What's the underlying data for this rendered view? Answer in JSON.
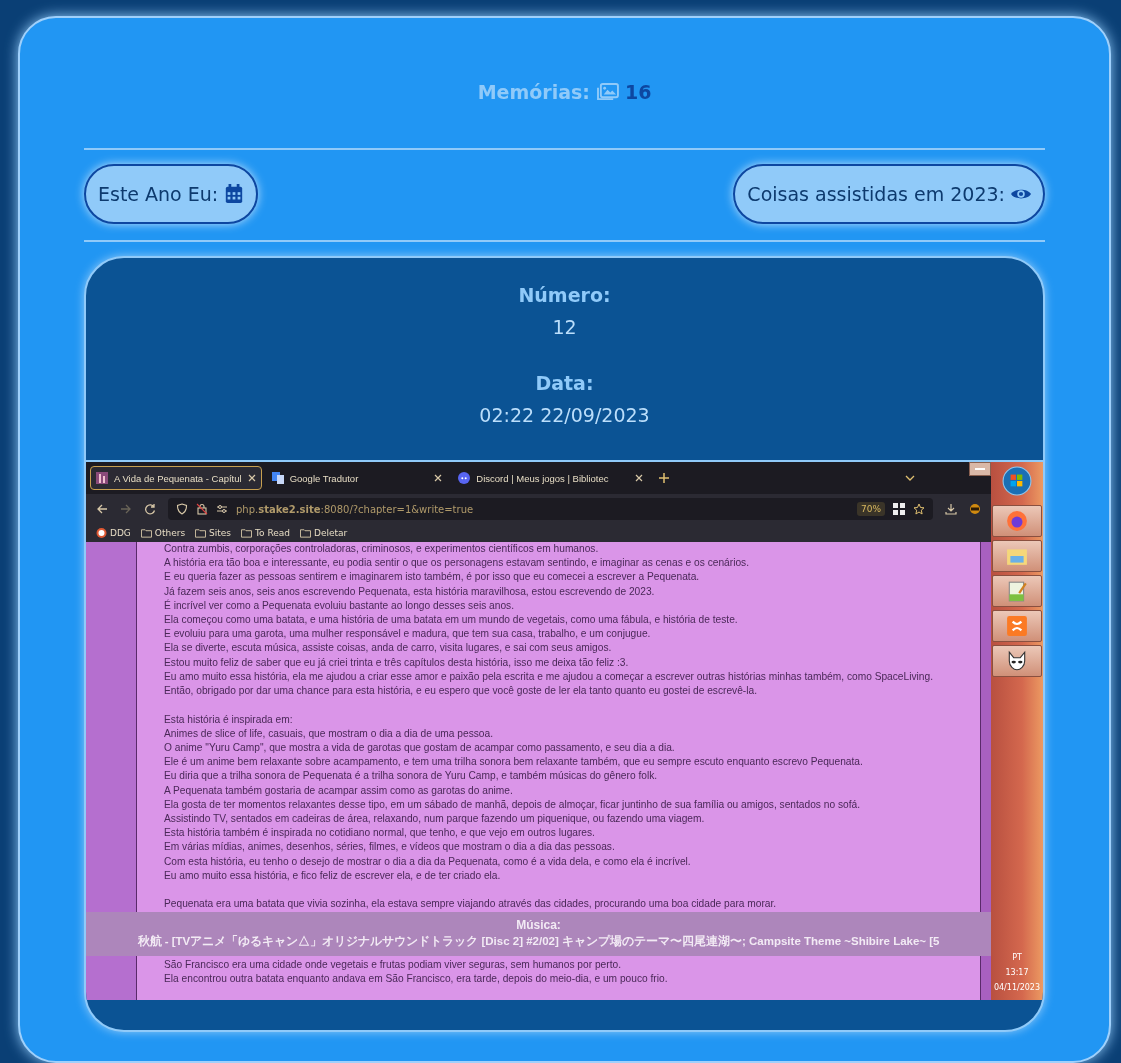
{
  "header": {
    "label": "Memórias:",
    "count": "16"
  },
  "buttons": [
    {
      "label": "Este Ano Eu:"
    },
    {
      "label": "Coisas assistidas em 2023:"
    }
  ],
  "memory": {
    "fields": [
      {
        "label": "Número:",
        "value": "12"
      },
      {
        "label": "Data:",
        "value": "02:22 22/09/2023"
      }
    ],
    "screenshot": {
      "browser": {
        "tabs": [
          {
            "title": "A Vida de Pequenata - Capítul",
            "selected": true
          },
          {
            "title": "Google Tradutor",
            "selected": false
          },
          {
            "title": "Discord | Meus jogos | Bibliotec",
            "selected": false
          }
        ],
        "address": "php.**stake2.site**:8080/?chapter=1&write=true",
        "zoom": "70%",
        "bookmarks": [
          "DDG",
          "Others",
          "Sites",
          "To Read",
          "Deletar"
        ]
      },
      "page_paragraphs": [
        [
          "Contra zumbis, corporações controladoras, criminosos, e experimentos científicos em humanos.",
          "A história era tão boa e interessante, eu podia sentir o que os personagens estavam sentindo, e imaginar as cenas e os cenários.",
          "E eu queria fazer as pessoas sentirem e imaginarem isto também, é por isso que eu comecei a escrever a Pequenata.",
          "Já fazem seis anos, seis anos escrevendo Pequenata, esta história maravilhosa, estou escrevendo de 2023.",
          "É incrível ver como a Pequenata evoluiu bastante ao longo desses seis anos.",
          "Ela começou como uma batata, e uma história de uma batata em um mundo de vegetais, como uma fábula, e história de teste.",
          "E evoluiu para uma garota, uma mulher responsável e madura, que tem sua casa, trabalho, e um conjugue.",
          "Ela se diverte, escuta música, assiste coisas, anda de carro, visita lugares, e sai com seus amigos.",
          "Estou muito feliz de saber que eu já criei trinta e três capítulos desta história, isso me deixa tão feliz :3.",
          "Eu amo muito essa história, ela me ajudou a criar esse amor e paixão pela escrita e me ajudou a começar a escrever outras histórias minhas também, como SpaceLiving.",
          "Então, obrigado por dar uma chance para esta história, e eu espero que você goste de ler ela tanto quanto eu gostei de escrevê-la."
        ],
        [
          "Esta história é inspirada em:",
          "Animes de slice of life, casuais, que mostram o dia a dia de uma pessoa.",
          "O anime \"Yuru Camp\", que mostra a vida de garotas que gostam de acampar como passamento, e seu dia a dia.",
          "Ele é um anime bem relaxante sobre acampamento, e tem uma trilha sonora bem relaxante também, que eu sempre escuto enquanto escrevo Pequenata.",
          "Eu diria que a trilha sonora de Pequenata é a trilha sonora de Yuru Camp, e também músicas do gênero folk.",
          "A Pequenata também gostaria de acampar assim como as garotas do anime.",
          "Ela gosta de ter momentos relaxantes desse tipo, em um sábado de manhã, depois de almoçar, ficar juntinho de sua família ou amigos, sentados no sofá.",
          "Assistindo TV, sentados em cadeiras de área, relaxando, num parque fazendo um piquenique, ou fazendo uma viagem.",
          "Esta história também é inspirada no cotidiano normal, que tenho, e que vejo em outros lugares.",
          "Em várias mídias, animes, desenhos, séries, filmes, e vídeos que mostram o dia a dia das pessoas.",
          "Com esta história, eu tenho o desejo de mostrar o dia a dia da Pequenata, como é a vida dela, e como ela é incrível.",
          "Eu amo muito essa história, e fico feliz de escrever ela, e de ter criado ela."
        ]
      ],
      "lines_above_music": [
        "Pequenata era uma batata que vivia sozinha, ela estava sempre viajando através das cidades, procurando uma boa cidade para morar."
      ],
      "music": {
        "label": "Música:",
        "title": "秋航 - [TVアニメ「ゆるキャン△」オリジナルサウンドトラック [Disc 2] #2/02] キャンプ場のテーマ〜四尾連湖〜; Campsite Theme ~Shibire Lake~ [5"
      },
      "lines_below_music": [
        "São Francisco era uma cidade onde vegetais e frutas podiam viver seguras, sem humanos por perto.",
        "Ela encontrou outra batata enquanto andava em São Francisco, era tarde, depois do meio-dia, e um pouco frio."
      ],
      "taskbar": {
        "language": "PT",
        "time": "13:17",
        "date": "04/11/2023"
      }
    }
  }
}
